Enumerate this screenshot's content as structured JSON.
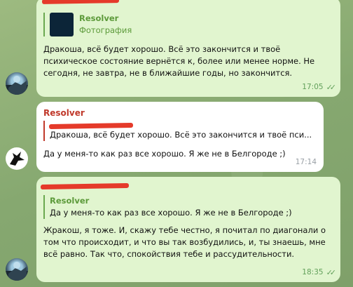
{
  "messages": [
    {
      "reply": {
        "name": "Resolver",
        "subtitle": "Фотография"
      },
      "text": "Дракоша, всё будет хорошо. Всё это закончится и твоё психическое состояние вернётся к, более или менее норме. Не сегодня, не завтра, не в ближайшие годы, но закончится.",
      "time": "17:05"
    },
    {
      "author": "Resolver",
      "reply": {
        "text": "Дракоша, всё будет хорошо. Всё это закончится и твоё пси..."
      },
      "text": "Да у меня-то как раз все хорошо. Я же не в Белгороде ;)",
      "time": "17:14"
    },
    {
      "reply": {
        "name": "Resolver",
        "text": "Да у меня-то как раз все хорошо. Я же не в Белгороде ;)"
      },
      "text": "Жракош, я тоже. И, скажу тебе честно, я почитал по диагонали о том что происходит, и что вы так возбудились, и, ты знаешь, мне всё равно. Так что, спокойствия тебе и рассудительности.",
      "time": "18:35"
    }
  ],
  "colors": {
    "outgoing_bubble": "#e1f5cf",
    "incoming_bubble": "#ffffff",
    "accent_green": "#5c9a3a",
    "author_red": "#c0392b",
    "redaction": "#e53a2a"
  },
  "icons": {
    "read_receipt": "double-check-icon"
  }
}
